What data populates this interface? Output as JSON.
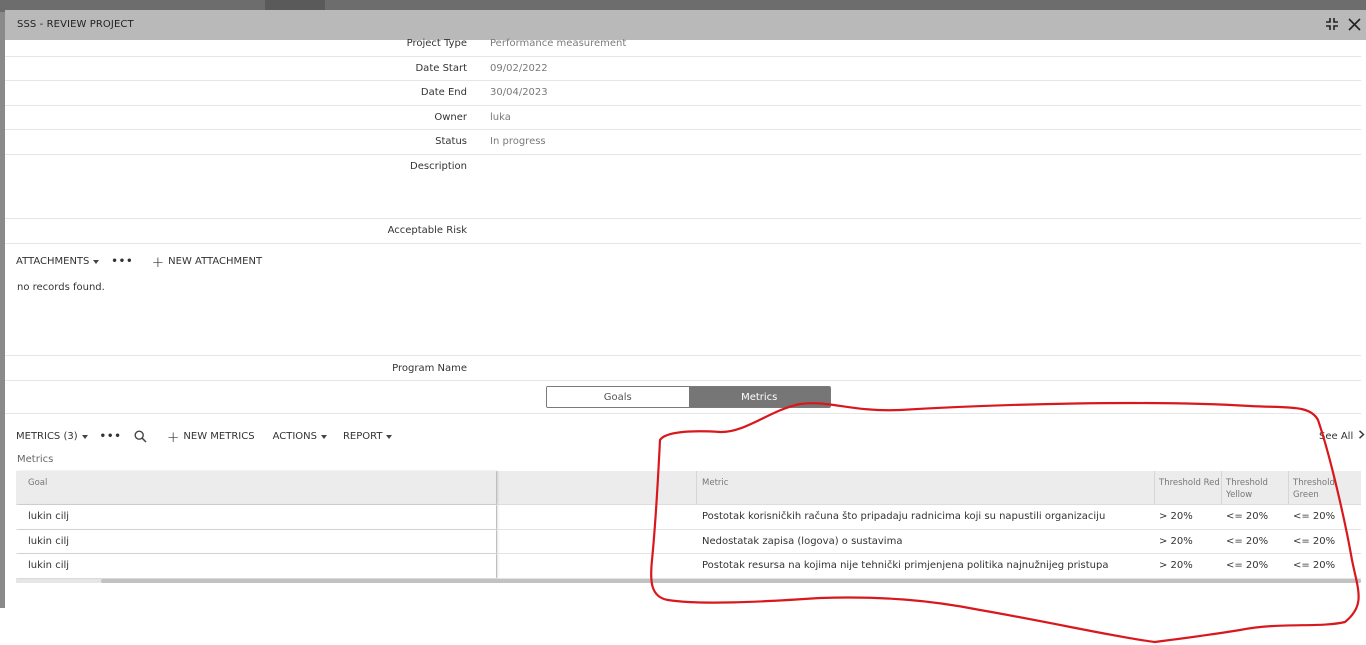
{
  "window": {
    "title": "SSS - REVIEW PROJECT",
    "collapse_icon": "collapse-arrows-icon",
    "close_icon": "close-icon"
  },
  "fields": [
    {
      "label": "Project Type",
      "value": "Performance measurement"
    },
    {
      "label": "Date Start",
      "value": "09/02/2022"
    },
    {
      "label": "Date End",
      "value": "30/04/2023"
    },
    {
      "label": "Owner",
      "value": "luka"
    },
    {
      "label": "Status",
      "value": "In progress"
    },
    {
      "label": "Description",
      "value": ""
    },
    {
      "label": "Acceptable Risk",
      "value": ""
    },
    {
      "label": "Program Name",
      "value": ""
    }
  ],
  "attachments": {
    "title": "ATTACHMENTS",
    "more": "•••",
    "new_label": "NEW ATTACHMENT",
    "empty_text": "no records found."
  },
  "toggle": {
    "goals_label": "Goals",
    "metrics_label": "Metrics",
    "active": "Metrics"
  },
  "metrics": {
    "title": "METRICS (3)",
    "more": "•••",
    "new_label": "NEW METRICS",
    "actions_label": "ACTIONS",
    "report_label": "REPORT",
    "see_all": "See All",
    "caption": "Metrics",
    "columns": {
      "goal": "Goal",
      "metric": "Metric",
      "threshold_red": "Threshold Red",
      "threshold_yellow_1": "Threshold",
      "threshold_yellow_2": "Yellow",
      "threshold_green_1": "Threshold",
      "threshold_green_2": "Green"
    },
    "rows": [
      {
        "goal": "lukin cilj",
        "metric": "Postotak korisničkih računa što pripadaju radnicima koji su napustili organizaciju",
        "red": "> 20%",
        "yellow": "<= 20%",
        "green": "<= 20%"
      },
      {
        "goal": "lukin cilj",
        "metric": "Nedostatak zapisa (logova) o sustavima",
        "red": "> 20%",
        "yellow": "<= 20%",
        "green": "<= 20%"
      },
      {
        "goal": "lukin cilj",
        "metric": "Postotak resursa na kojima nije tehnički primjenjena politika najnužnijeg pristupa",
        "red": "> 20%",
        "yellow": "<= 20%",
        "green": "<= 20%"
      }
    ]
  },
  "colors": {
    "header_bg": "#b9b9b9",
    "toggle_active": "#767676",
    "annotation": "#d9181e"
  }
}
